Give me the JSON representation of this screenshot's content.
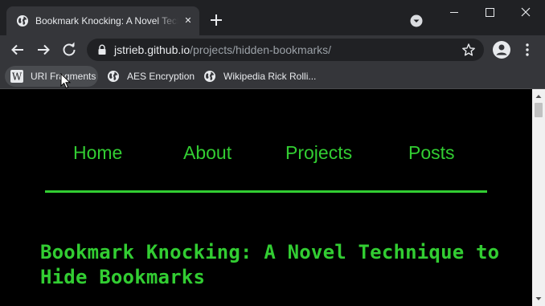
{
  "browser": {
    "tab": {
      "title": "Bookmark Knocking: A Novel Technique to Hide Bookmarks",
      "close_symbol": "✕",
      "favicon": "globe-icon"
    },
    "address_bar": {
      "host": "jstrieb.github.io",
      "path": "/projects/hidden-bookmarks/"
    },
    "bookmarks": [
      {
        "label": "URI Fragments",
        "icon": "wikipedia-icon"
      },
      {
        "label": "AES Encryption",
        "icon": "globe-icon"
      },
      {
        "label": "Wikipedia Rick Rolli...",
        "icon": "globe-icon"
      }
    ],
    "colors": {
      "tab_strip": "#202124",
      "toolbar": "#35363a",
      "text": "#e8eaed"
    }
  },
  "page": {
    "nav": [
      "Home",
      "About",
      "Projects",
      "Posts"
    ],
    "title": "Bookmark Knocking: A Novel Technique to Hide Bookmarks",
    "colors": {
      "background": "#000000",
      "accent": "#32cd32"
    }
  }
}
